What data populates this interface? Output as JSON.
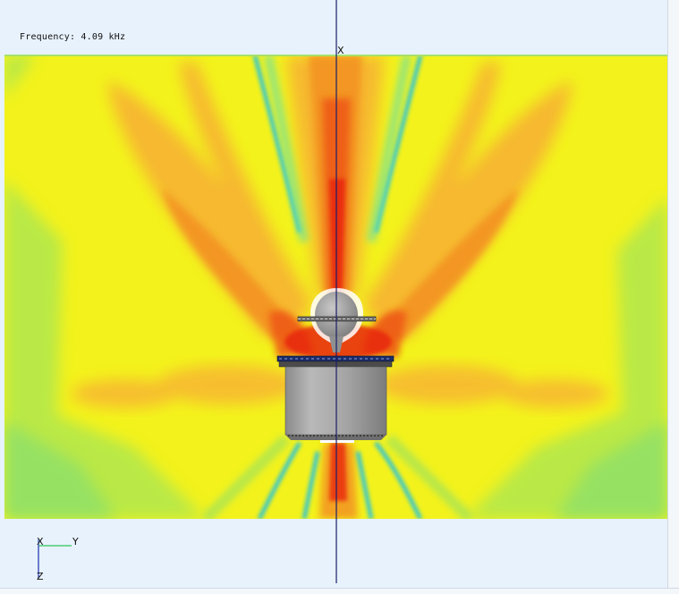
{
  "status": {
    "frequency_text": "Frequency: 4.09 kHz"
  },
  "section_axis": {
    "label": "X"
  },
  "triad": {
    "x_label": "X",
    "y_label": "Y",
    "z_label": "Z",
    "colors": {
      "x": "#2f5fc0",
      "y": "#2ec65a",
      "z": "#1a2fb0"
    }
  },
  "colormap": {
    "low": "#1ab7e8",
    "mid_low": "#8fe36a",
    "mid": "#f6f21e",
    "mid_high": "#f5a623",
    "high": "#ea2a0d"
  },
  "model": {
    "body_color": "#a9a9a9",
    "flange_color": "#1b2c6b"
  }
}
